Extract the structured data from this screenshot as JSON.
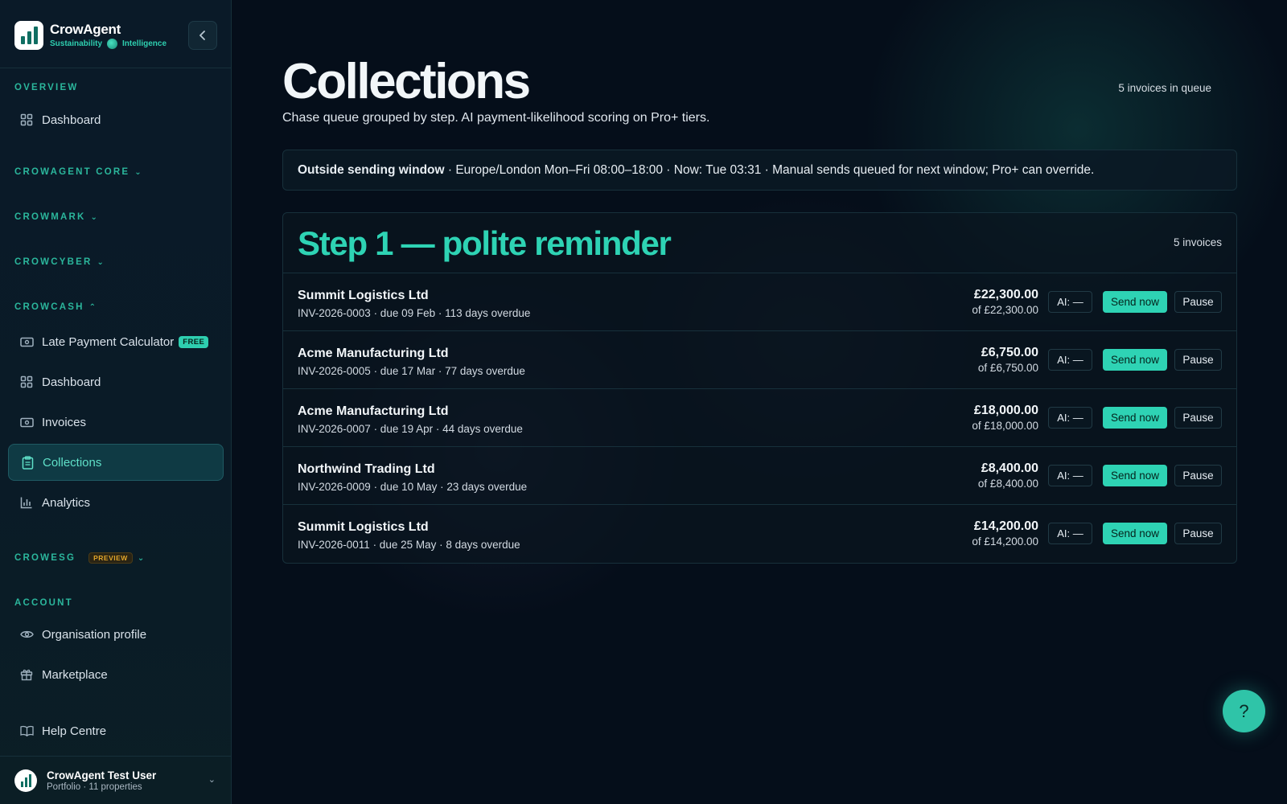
{
  "brand": {
    "name": "CrowAgent",
    "tagline_left": "Sustainability",
    "tagline_right": "Intelligence"
  },
  "sidebar": {
    "sections": {
      "overview": "OVERVIEW",
      "core": "CROWAGENT CORE",
      "mark": "CROWMARK",
      "cyber": "CROWCYBER",
      "cash": "CROWCASH",
      "esg": "CROWESG",
      "esg_badge": "PREVIEW",
      "account": "ACCOUNT"
    },
    "items": {
      "dashboard_overview": "Dashboard",
      "late_payment": "Late Payment Calculator",
      "late_payment_badge": "FREE",
      "cash_dashboard": "Dashboard",
      "invoices": "Invoices",
      "collections": "Collections",
      "analytics": "Analytics",
      "org_profile": "Organisation profile",
      "marketplace": "Marketplace",
      "help_centre": "Help Centre"
    },
    "user": {
      "name": "CrowAgent Test User",
      "subtitle": "Portfolio · 11 properties"
    }
  },
  "page": {
    "title": "Collections",
    "subtitle": "Chase queue grouped by step. AI payment-likelihood scoring on Pro+ tiers.",
    "queue_count": "5 invoices in queue"
  },
  "notice": {
    "bold": "Outside sending window",
    "text": " · Europe/London Mon–Fri 08:00–18:00 · Now: Tue 03:31 · Manual sends queued for next window; Pro+ can override."
  },
  "step": {
    "title": "Step 1 — polite reminder",
    "count": "5 invoices",
    "send_label": "Send now",
    "pause_label": "Pause",
    "invoices": [
      {
        "customer": "Summit Logistics Ltd",
        "meta": "INV-2026-0003 · due 09 Feb · 113 days overdue",
        "amount": "£22,300.00",
        "of": "of £22,300.00",
        "ai": "AI: —"
      },
      {
        "customer": "Acme Manufacturing Ltd",
        "meta": "INV-2026-0005 · due 17 Mar · 77 days overdue",
        "amount": "£6,750.00",
        "of": "of £6,750.00",
        "ai": "AI: —"
      },
      {
        "customer": "Acme Manufacturing Ltd",
        "meta": "INV-2026-0007 · due 19 Apr · 44 days overdue",
        "amount": "£18,000.00",
        "of": "of £18,000.00",
        "ai": "AI: —"
      },
      {
        "customer": "Northwind Trading Ltd",
        "meta": "INV-2026-0009 · due 10 May · 23 days overdue",
        "amount": "£8,400.00",
        "of": "of £8,400.00",
        "ai": "AI: —"
      },
      {
        "customer": "Summit Logistics Ltd",
        "meta": "INV-2026-0011 · due 25 May · 8 days overdue",
        "amount": "£14,200.00",
        "of": "of £14,200.00",
        "ai": "AI: —"
      }
    ]
  },
  "help": {
    "label": "?"
  },
  "colors": {
    "accent": "#2ed3b4",
    "background": "#050e1a",
    "sidebar": "#0a1a28"
  }
}
